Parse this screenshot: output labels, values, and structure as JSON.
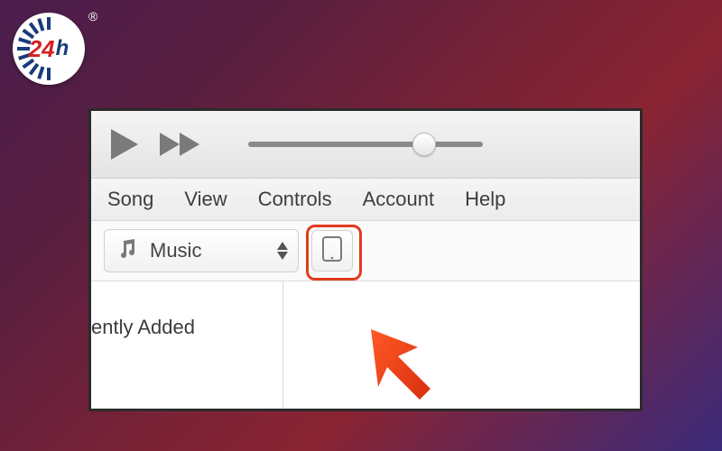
{
  "watermark": {
    "text_num": "24",
    "text_h": "h",
    "registered": "®"
  },
  "playback": {
    "volume_percent": 75
  },
  "menu": {
    "items": [
      "Song",
      "View",
      "Controls",
      "Account",
      "Help"
    ]
  },
  "library_selector": {
    "icon": "music-note",
    "label": "Music"
  },
  "device_button": {
    "icon": "ipad"
  },
  "sidebar": {
    "items": [
      {
        "label": "ently Added",
        "full_label_hint": "Recently Added"
      }
    ]
  }
}
